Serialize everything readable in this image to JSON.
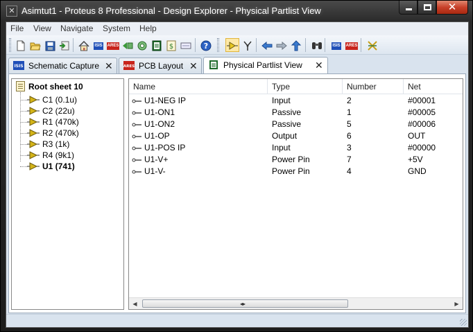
{
  "window": {
    "title": "Asimtut1 - Proteus 8 Professional - Design Explorer - Physical Partlist View"
  },
  "menu": [
    "File",
    "View",
    "Navigate",
    "System",
    "Help"
  ],
  "toolbar": {
    "buttons": [
      "new-file",
      "open-folder",
      "save",
      "import",
      "home",
      "isis-schematic",
      "ares-pcb",
      "gerber-viewer",
      "3d-visualizer",
      "bill-of-materials",
      "design-explorer",
      "help",
      "navigate-parts",
      "navigate-nets",
      "back",
      "forward",
      "up",
      "find",
      "isis-open",
      "ares-open",
      "netlist-compare"
    ],
    "logo_isis": "ISIS",
    "logo_ares": "ARES"
  },
  "tabs": [
    {
      "label": "Schematic Capture",
      "icon": "isis-icon",
      "active": false
    },
    {
      "label": "PCB Layout",
      "icon": "ares-icon",
      "active": false
    },
    {
      "label": "Physical Partlist View",
      "icon": "partlist-icon",
      "active": true
    }
  ],
  "tree": {
    "root": "Root sheet 10",
    "items": [
      {
        "label": "C1 (0.1u)",
        "selected": false
      },
      {
        "label": "C2 (22u)",
        "selected": false
      },
      {
        "label": "R1 (470k)",
        "selected": false
      },
      {
        "label": "R2 (470k)",
        "selected": false
      },
      {
        "label": "R3 (1k)",
        "selected": false
      },
      {
        "label": "R4 (9k1)",
        "selected": false
      },
      {
        "label": "U1 (741)",
        "selected": true
      }
    ]
  },
  "table": {
    "columns": [
      "Name",
      "Type",
      "Number",
      "Net"
    ],
    "rows": [
      {
        "name": "U1-NEG IP",
        "type": "Input",
        "number": "2",
        "net": "#00001"
      },
      {
        "name": "U1-ON1",
        "type": "Passive",
        "number": "1",
        "net": "#00005"
      },
      {
        "name": "U1-ON2",
        "type": "Passive",
        "number": "5",
        "net": "#00006"
      },
      {
        "name": "U1-OP",
        "type": "Output",
        "number": "6",
        "net": "OUT"
      },
      {
        "name": "U1-POS IP",
        "type": "Input",
        "number": "3",
        "net": "#00000"
      },
      {
        "name": "U1-V+",
        "type": "Power Pin",
        "number": "7",
        "net": "+5V"
      },
      {
        "name": "U1-V-",
        "type": "Power Pin",
        "number": "4",
        "net": "GND"
      }
    ]
  },
  "scrollbar": {
    "grip": "◂▸"
  },
  "colors": {
    "accent_isis": "#1f4fb8",
    "accent_ares": "#c8241c",
    "component_icon": "#d4b418",
    "active_toolbar": "#fde9a8"
  }
}
